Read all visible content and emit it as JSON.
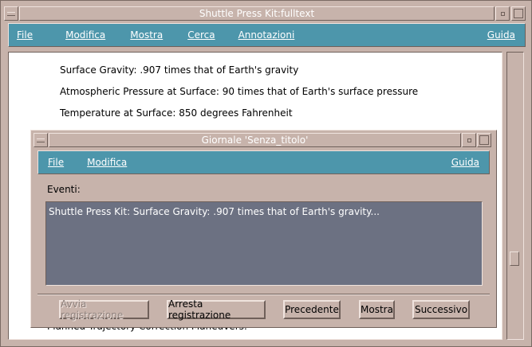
{
  "main_window": {
    "title": "Shuttle Press Kit:fulltext",
    "menu": [
      "File",
      "Modifica",
      "Mostra",
      "Cerca",
      "Annotazioni"
    ],
    "help": "Guida",
    "lines": [
      "Surface Gravity: .907 times that of Earth's gravity",
      "Atmospheric Pressure at Surface: 90 times that of Earth's surface pressure",
      "Temperature at Surface: 850 degrees Fahrenheit"
    ],
    "partial_line": "Planned Trajectory Correction Maneuvers:"
  },
  "dialog": {
    "title": "Giornale 'Senza_titolo'",
    "menu": [
      "File",
      "Modifica"
    ],
    "help": "Guida",
    "events_label": "Eventi:",
    "log_entry": "Shuttle Press Kit: Surface Gravity: .907 times that of Earth's gravity...",
    "buttons": {
      "start": "Avvia registrazione",
      "stop": "Arresta registrazione",
      "prev": "Precedente",
      "show": "Mostra",
      "next": "Successivo"
    }
  }
}
